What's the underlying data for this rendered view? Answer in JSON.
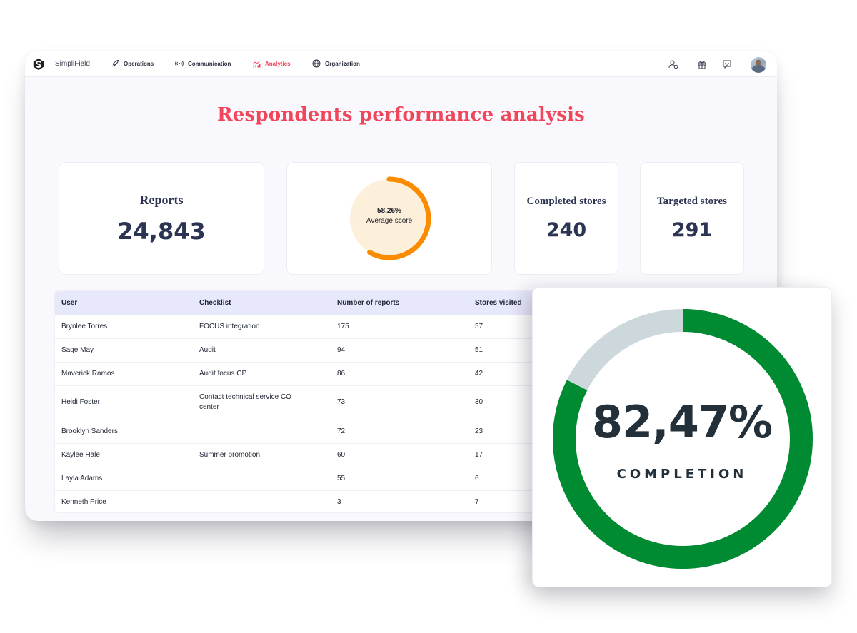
{
  "app": {
    "brand": "SimpliField"
  },
  "nav": {
    "items": [
      {
        "label": "Operations",
        "icon": "rocket-icon",
        "active": false
      },
      {
        "label": "Communication",
        "icon": "broadcast-icon",
        "active": false
      },
      {
        "label": "Analytics",
        "icon": "chart-icon",
        "active": true
      },
      {
        "label": "Organization",
        "icon": "globe-icon",
        "active": false
      }
    ],
    "right_icons": [
      "user-settings-icon",
      "gift-icon",
      "chat-icon",
      "avatar"
    ]
  },
  "page": {
    "title": "Respondents performance analysis"
  },
  "stats": {
    "reports": {
      "label": "Reports",
      "value": "24,843"
    },
    "average_score": {
      "value": "58,26%",
      "label": "Average score",
      "percent": 58.26
    },
    "completed_stores": {
      "label": "Completed stores",
      "value": "240"
    },
    "targeted_stores": {
      "label": "Targeted stores",
      "value": "291"
    }
  },
  "table": {
    "headers": [
      "User",
      "Checklist",
      "Number of reports",
      "Stores visited"
    ],
    "rows": [
      {
        "user": "Brynlee Torres",
        "checklist": "FOCUS integration",
        "reports": "175",
        "stores": "57"
      },
      {
        "user": "Sage May",
        "checklist": "Audit",
        "reports": "94",
        "stores": "51"
      },
      {
        "user": "Maverick Ramos",
        "checklist": "Audit focus CP",
        "reports": "86",
        "stores": "42"
      },
      {
        "user": "Heidi Foster",
        "checklist": "Contact technical service CO center",
        "reports": "73",
        "stores": "30"
      },
      {
        "user": "Brooklyn Sanders",
        "checklist": "",
        "reports": "72",
        "stores": "23"
      },
      {
        "user": "Kaylee Hale",
        "checklist": "Summer promotion",
        "reports": "60",
        "stores": "17"
      },
      {
        "user": "Layla Adams",
        "checklist": "",
        "reports": "55",
        "stores": "6"
      },
      {
        "user": "Kenneth Price",
        "checklist": "",
        "reports": "3",
        "stores": "7"
      }
    ]
  },
  "completion": {
    "value": "82,47%",
    "label": "COMPLETION",
    "percent": 82.47
  },
  "colors": {
    "accent": "#f0455b",
    "score_arc": "#fb8c00",
    "score_bg": "#fdf0db",
    "completion_arc": "#008a31",
    "completion_track": "#cdd8dc",
    "header_row": "#e8e8fb"
  }
}
